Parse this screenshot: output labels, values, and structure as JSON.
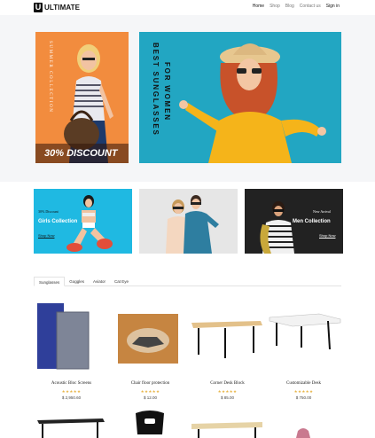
{
  "header": {
    "logo_mark": "U",
    "logo_text": "ULTIMATE",
    "nav": [
      "Home",
      "Shop",
      "Blog",
      "Contact us",
      "Sign in"
    ]
  },
  "hero": {
    "left_vertical": "SUMMER COLLECTION",
    "discount": "30% DISCOUNT",
    "right_line1": "BEST SUNGLASSES",
    "right_line2": "FOR WOMEN"
  },
  "banners": [
    {
      "small": "30% Discount",
      "title": "Girls Collection",
      "link": "Shop Now"
    },
    {
      "small": "",
      "title": "",
      "link": ""
    },
    {
      "small": "New Arrival",
      "title": "Men Collection",
      "link": "Shop Now"
    }
  ],
  "tabs": [
    "Sunglasses",
    "Goggles",
    "Aviator",
    "Cat Eye"
  ],
  "products": [
    {
      "name": "Acoustic Bloc Screens",
      "stars": "★★★★★",
      "price": "$ 2,950.60"
    },
    {
      "name": "Chair floor protection",
      "stars": "★★★★★",
      "price": "$ 12.00"
    },
    {
      "name": "Corner Desk Block",
      "stars": "★★★★★",
      "price": "$ 85.00"
    },
    {
      "name": "Customizable Desk",
      "stars": "★★★★★",
      "price": "$ 750.00"
    }
  ],
  "colors": {
    "hero_left_bg": "#f28c3e",
    "hero_right_bg": "#22a6c2",
    "banner1_bg": "#1fb9e2",
    "banner3_bg": "#222222",
    "star": "#e8b64a"
  }
}
